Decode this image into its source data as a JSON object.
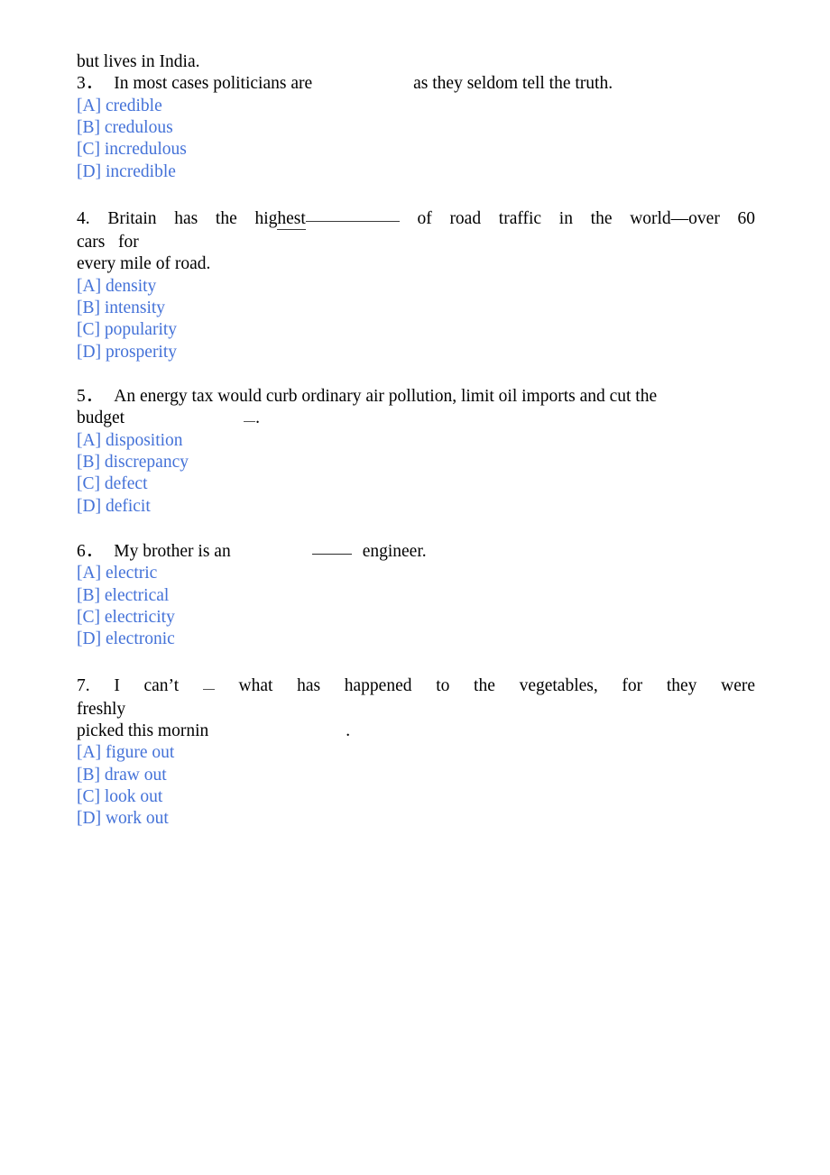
{
  "document": {
    "type": "english-multiple-choice-exercise",
    "text_color": "#000000",
    "option_color": "#4472d8",
    "blank_rule_color": "#3a3a3a"
  },
  "intro": {
    "carryover_line": "but lives in India."
  },
  "questions": [
    {
      "number": "3．",
      "stem_part1": "In most cases politicians are",
      "stem_gap": "blank-space",
      "stem_part2": "as they seldom tell the truth.",
      "options": [
        {
          "marker": "[A]",
          "text": "credible"
        },
        {
          "marker": "[B]",
          "text": "credulous"
        },
        {
          "marker": "[C]",
          "text": "incredulous"
        },
        {
          "marker": "[D]",
          "text": "incredible"
        }
      ]
    },
    {
      "number": "4.",
      "justified_words": [
        "Britain",
        "has",
        "the"
      ],
      "underlined_word_head": "hig",
      "underlined_word_tail": "hest",
      "justified_words_after": [
        "of",
        "road",
        "traffic",
        "in",
        "the",
        "world—over",
        "60"
      ],
      "line2": "cars   for",
      "line3": "every mile of road.",
      "options": [
        {
          "marker": "[A]",
          "text": "density"
        },
        {
          "marker": "[B]",
          "text": "intensity"
        },
        {
          "marker": "[C]",
          "text": "popularity"
        },
        {
          "marker": "[D]",
          "text": "prosperity"
        }
      ]
    },
    {
      "number": "5．",
      "line1": "An energy tax would curb ordinary air pollution, limit oil imports and cut the",
      "line2_word": "budget",
      "line2_tail": ".",
      "options": [
        {
          "marker": "[A]",
          "text": "disposition"
        },
        {
          "marker": "[B]",
          "text": "discrepancy"
        },
        {
          "marker": "[C]",
          "text": "defect"
        },
        {
          "marker": "[D]",
          "text": "deficit"
        }
      ]
    },
    {
      "number": "6．",
      "stem_part1": "My brother is an",
      "stem_part2": "engineer.",
      "options": [
        {
          "marker": "[A]",
          "text": "electric"
        },
        {
          "marker": "[B]",
          "text": "electrical"
        },
        {
          "marker": "[C]",
          "text": "electricity"
        },
        {
          "marker": "[D]",
          "text": "electronic"
        }
      ]
    },
    {
      "number": "7.",
      "justified_head": [
        "I",
        "can’t"
      ],
      "justified_tail": [
        "what",
        "has",
        "happened",
        "to",
        "the",
        "vegetables,",
        "for",
        "they",
        "were"
      ],
      "line2": "freshly",
      "line3_word": "picked this mornin",
      "line3_tail": ".",
      "options": [
        {
          "marker": "[A]",
          "text": "figure out"
        },
        {
          "marker": "[B]",
          "text": "draw out"
        },
        {
          "marker": "[C]",
          "text": "look out"
        },
        {
          "marker": "[D]",
          "text": "work out"
        }
      ]
    }
  ]
}
